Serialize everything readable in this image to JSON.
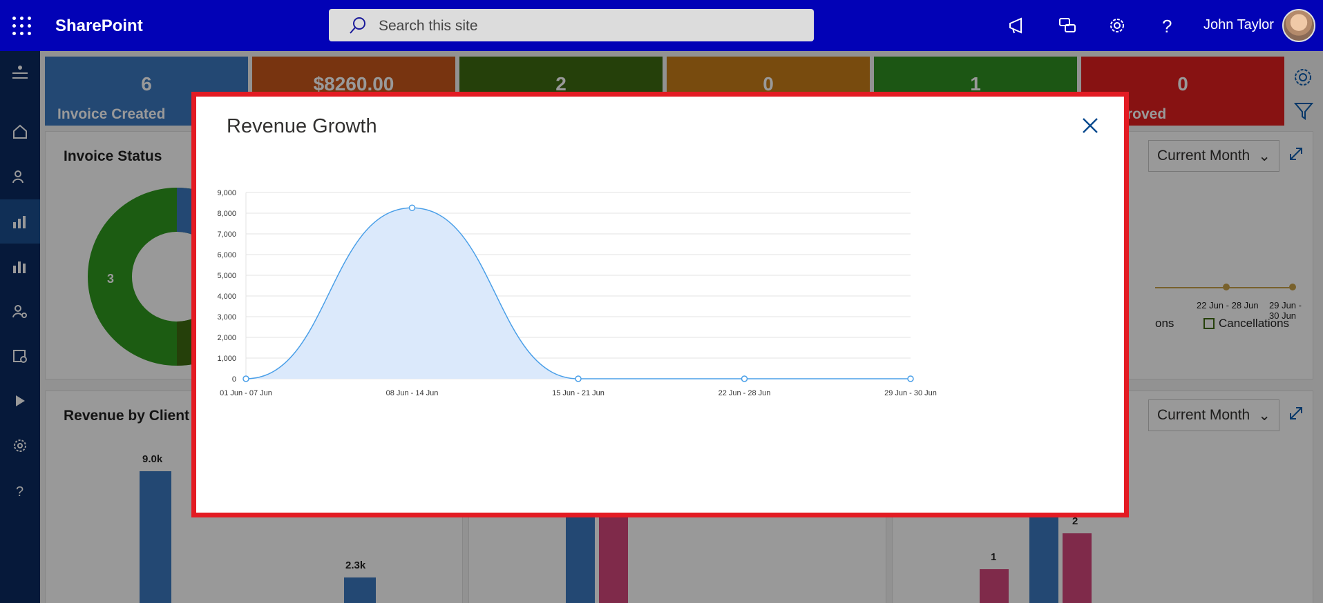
{
  "app": {
    "brand": "SharePoint"
  },
  "search": {
    "placeholder": "Search this site"
  },
  "user": {
    "name": "John Taylor"
  },
  "tiles": [
    {
      "value": "6",
      "label": "Invoice Created",
      "color": "#3b78c0"
    },
    {
      "value": "$8260.00",
      "label": "",
      "color": "#c9571c"
    },
    {
      "value": "2",
      "label": "",
      "color": "#3e6b12"
    },
    {
      "value": "0",
      "label": "",
      "color": "#c97d18"
    },
    {
      "value": "1",
      "label": "",
      "color": "#2f8f22"
    },
    {
      "value": "0",
      "label": "roved",
      "color": "#e21f1f"
    }
  ],
  "cards": {
    "invoice_status": {
      "title": "Invoice Status",
      "donut_label": "3"
    },
    "revenue_by_client": {
      "title": "Revenue by Client",
      "bar_labels": [
        "9.0k",
        "2.3k"
      ]
    },
    "right_top": {
      "dropdown": "Current Month",
      "x_labels": [
        "22 Jun - 28 Jun",
        "29 Jun - 30 Jun"
      ],
      "legend": [
        "ons",
        "Cancellations"
      ]
    },
    "right_bottom": {
      "dropdown": "Current Month",
      "bar_labels": [
        "1",
        "2"
      ]
    }
  },
  "modal": {
    "title": "Revenue Growth",
    "chart_data": {
      "type": "area",
      "categories": [
        "01 Jun - 07 Jun",
        "08 Jun - 14 Jun",
        "15 Jun - 21 Jun",
        "22 Jun - 28 Jun",
        "29 Jun - 30 Jun"
      ],
      "values": [
        0,
        8260,
        0,
        0,
        0
      ],
      "ylim": [
        0,
        9000
      ],
      "yticks": [
        "0",
        "1,000",
        "2,000",
        "3,000",
        "4,000",
        "5,000",
        "6,000",
        "7,000",
        "8,000",
        "9,000"
      ],
      "grid": true,
      "line_color": "#4a9fe8",
      "fill_color": "#dbe9fb"
    }
  }
}
